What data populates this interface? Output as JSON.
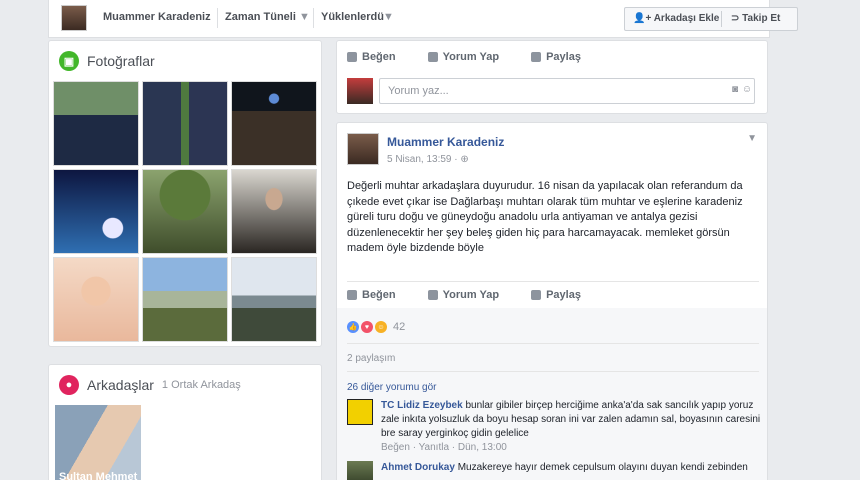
{
  "profile_bar": {
    "name": "Muammer Karadeniz",
    "timeline": "Zaman Tüneli",
    "uploaded": "Yüklenlerdü",
    "add_friend": "Arkadaşı Ekle",
    "follow": "Takip Et"
  },
  "photos": {
    "title": "Fotoğraflar",
    "items": [
      "photo-two-men",
      "photo-two-men-2",
      "photo-crowd-night",
      "photo-mosque-night",
      "photo-tree",
      "photo-man-portrait",
      "photo-baby",
      "photo-village",
      "photo-landscape"
    ]
  },
  "friends": {
    "title": "Arkadaşlar",
    "mutual": "1 Ortak Arkadaş",
    "first_friend_name": "Sultan Mehmet"
  },
  "composer": {
    "like": "Beğen",
    "comment": "Yorum Yap",
    "share": "Paylaş",
    "placeholder": "Yorum yaz..."
  },
  "post": {
    "author": "Muammer Karadeniz",
    "time": "5 Nisan, 13:59 · ⊕",
    "text": "Değerli muhtar arkadaşlara duyurudur. 16 nisan da yapılacak olan referandum da çıkede evet çıkar ise Dağlarbaşı muhtarı olarak tüm muhtar ve eşlerine karadeniz güreli turu doğu ve güneydoğu anadolu urla antiyaman ve antalya gezisi düzenlenecektir her şey beleş giden hiç para harcamayacak. memleket görsün madem öyle bizdende böyle",
    "like": "Beğen",
    "comment": "Yorum Yap",
    "share": "Paylaş",
    "reaction_count": "42",
    "shares": "2 paylaşım",
    "more_comments": "26 diğer yorumu gör",
    "comments": [
      {
        "name": "TC Lidiz Ezeybek",
        "text": "bunlar gibiler birçep herciğime anka'a'da sak sancılık yapıp yoruz zale inkıta yolsuzluk da boyu hesap soran ini var zalen adamın sal, boyasının caresini bre saray yerginkoç gidin gelelice",
        "meta": "Beğen · Yanıtla · Dün, 13:00"
      },
      {
        "name": "Ahmet Dorukay",
        "text": "Muzakereye hayır demek cepulsum olayını duyan kendi zebinden",
        "meta": ""
      }
    ]
  },
  "colors": {
    "page_bg": "#e9ebee",
    "link_blue": "#365899",
    "photos_icon": "#42b72a",
    "friends_icon": "#e0245e"
  }
}
